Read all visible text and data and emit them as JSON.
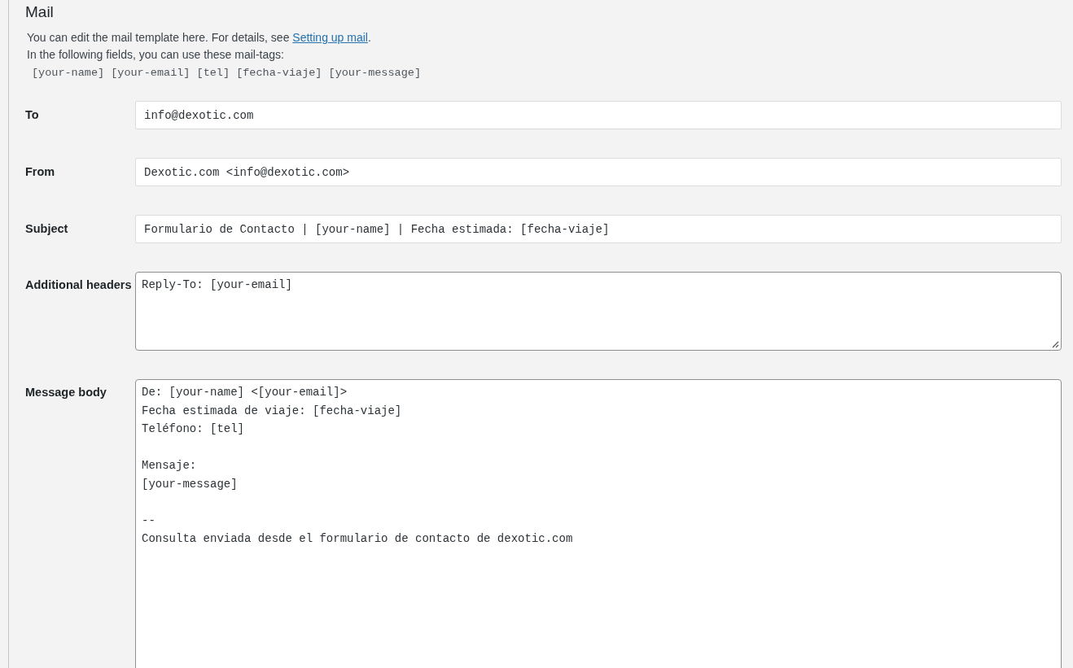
{
  "section": {
    "title": "Mail",
    "description": "You can edit the mail template here. For details, see ",
    "link": "Setting up mail",
    "description_end": ".",
    "tags_intro": "In the following fields, you can use these mail-tags:",
    "tags": "[your-name] [your-email] [tel] [fecha-viaje] [your-message]"
  },
  "fields": [
    {
      "label": "To",
      "kind": "input",
      "value": "info@dexotic.com"
    },
    {
      "label": "From",
      "kind": "input",
      "value": "Dexotic.com <info@dexotic.com>"
    },
    {
      "label": "Subject",
      "kind": "input",
      "value": "Formulario de Contacto | [your-name] | Fecha estimada: [fecha-viaje]"
    },
    {
      "label": "Additional headers",
      "kind": "textarea",
      "value": "Reply-To: [your-email]"
    },
    {
      "label": "Message body",
      "kind": "textarea-cut",
      "value": "De: [your-name] <[your-email]>\nFecha estimada de viaje: [fecha-viaje]\nTeléfono: [tel]\n\nMensaje:\n[your-message]\n\n--\nConsulta enviada desde el formulario de contacto de dexotic.com"
    }
  ]
}
